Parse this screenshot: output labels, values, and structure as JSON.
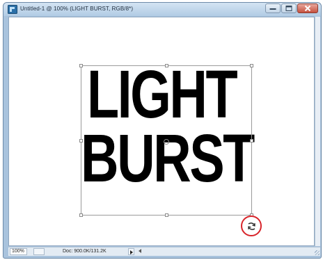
{
  "window": {
    "title": "Untitled-1 @ 100% (LIGHT BURST, RGB/8*)",
    "app_icon": "photoshop-doc-icon",
    "controls": [
      "minimize-icon",
      "maximize-icon",
      "close-icon"
    ]
  },
  "canvas": {
    "text_line_1": "LIGHT",
    "text_line_2": "BURST",
    "text_color": "#000000",
    "transform_handles": 8,
    "cursor": "rotate-cursor-icon",
    "highlight_color": "#d8242a"
  },
  "statusbar": {
    "zoom": "100%",
    "doc_info": "Doc: 900.0K/131.2K"
  }
}
